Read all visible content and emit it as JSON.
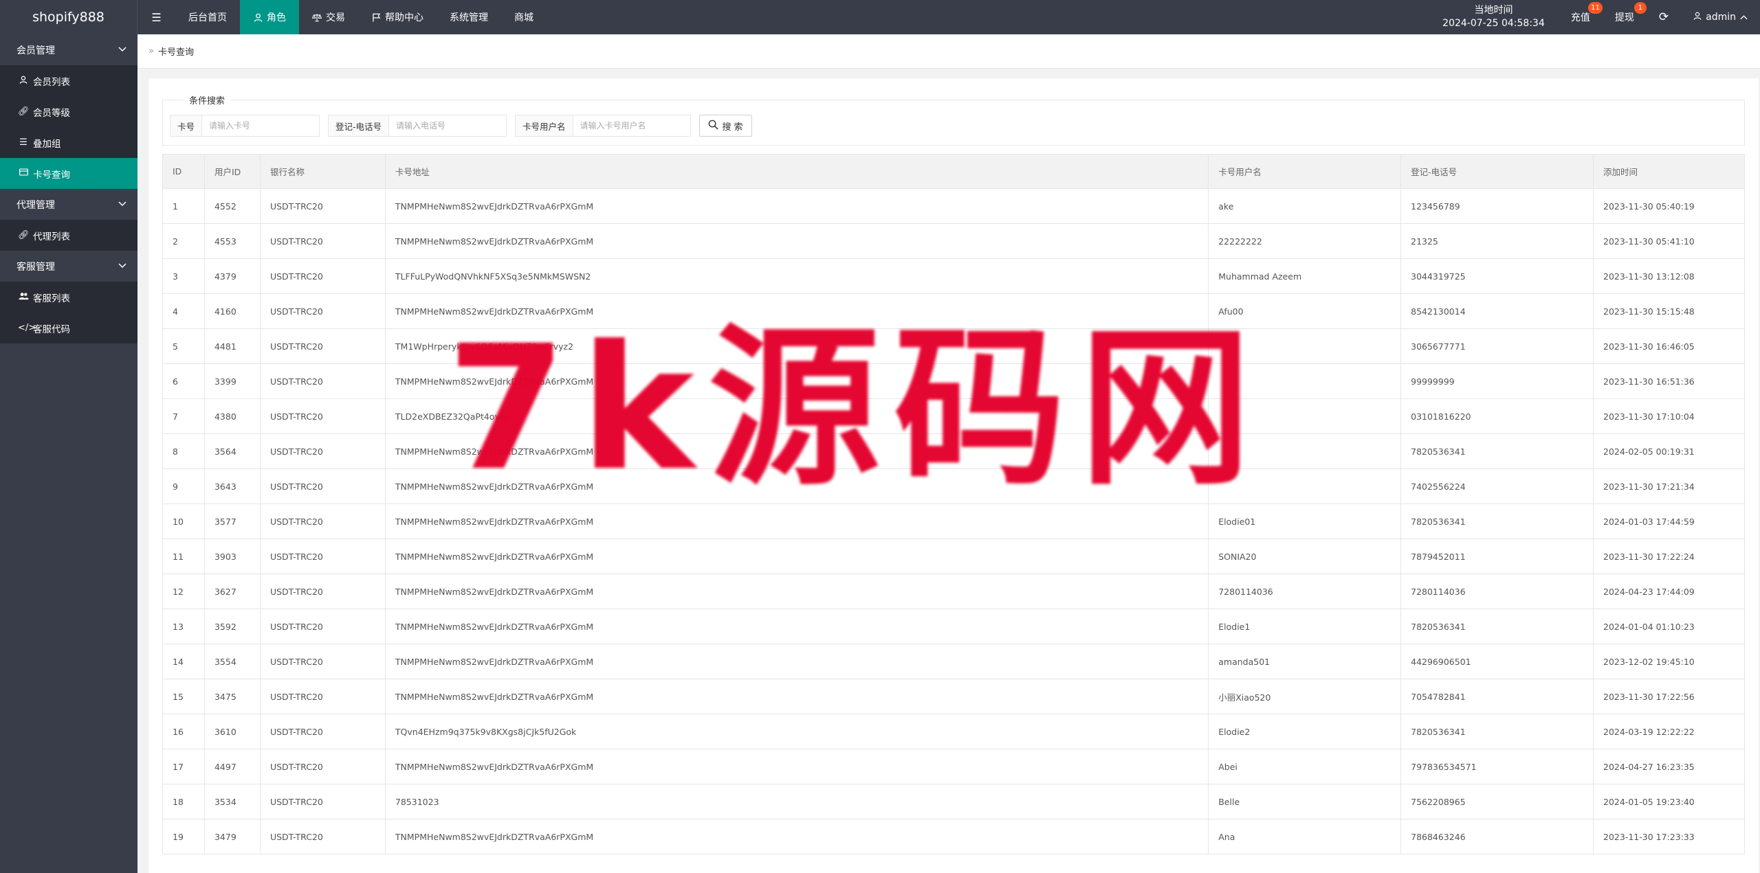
{
  "app": {
    "logo": "shopify888"
  },
  "top_nav": {
    "items": [
      {
        "label": "后台首页",
        "icon": ""
      },
      {
        "label": "角色",
        "icon": "user-icon",
        "active": true
      },
      {
        "label": "交易",
        "icon": "scale-icon"
      },
      {
        "label": "帮助中心",
        "icon": "flag-icon"
      },
      {
        "label": "系统管理",
        "icon": ""
      },
      {
        "label": "商城",
        "icon": ""
      }
    ]
  },
  "header_right": {
    "time_label": "当地时间",
    "time_value": "2024-07-25 04:58:34",
    "recharge_label": "充值",
    "recharge_badge": "11",
    "withdraw_label": "提现",
    "withdraw_badge": "1",
    "admin_label": "admin"
  },
  "sidebar": {
    "groups": [
      {
        "label": "会员管理",
        "items": [
          "会员列表",
          "会员等级",
          "叠加组",
          "卡号查询"
        ]
      },
      {
        "label": "代理管理",
        "items": [
          "代理列表"
        ]
      },
      {
        "label": "客服管理",
        "items": [
          "客服列表",
          "客服代码"
        ]
      }
    ]
  },
  "breadcrumb": {
    "current": "卡号查询"
  },
  "search": {
    "legend": "条件搜索",
    "card_label": "卡号",
    "card_placeholder": "请输入卡号",
    "phone_label": "登记-电话号",
    "phone_placeholder": "请输入电话号",
    "username_label": "卡号用户名",
    "username_placeholder": "请输入卡号用户名",
    "button_label": "搜 索"
  },
  "table": {
    "headers": [
      "ID",
      "用户ID",
      "银行名称",
      "卡号地址",
      "卡号用户名",
      "登记-电话号",
      "添加时间"
    ],
    "rows": [
      [
        "1",
        "4552",
        "USDT-TRC20",
        "TNMPMHeNwm8S2wvEJdrkDZTRvaA6rPXGmM",
        "ake",
        "123456789",
        "2023-11-30 05:40:19"
      ],
      [
        "2",
        "4553",
        "USDT-TRC20",
        "TNMPMHeNwm8S2wvEJdrkDZTRvaA6rPXGmM",
        "22222222",
        "21325",
        "2023-11-30 05:41:10"
      ],
      [
        "3",
        "4379",
        "USDT-TRC20",
        "TLFFuLPyWodQNVhkNF5XSq3e5NMkMSWSN2",
        "Muhammad Azeem",
        "3044319725",
        "2023-11-30 13:12:08"
      ],
      [
        "4",
        "4160",
        "USDT-TRC20",
        "TNMPMHeNwm8S2wvEJdrkDZTRvaA6rPXGmM",
        "Afu00",
        "8542130014",
        "2023-11-30 15:15:48"
      ],
      [
        "5",
        "4481",
        "USDT-TRC20",
        "TM1WpHrperykJJrv6Q6aMjvDH79w6rvyz2",
        "",
        "3065677771",
        "2023-11-30 16:46:05"
      ],
      [
        "6",
        "3399",
        "USDT-TRC20",
        "TNMPMHeNwm8S2wvEJdrkDZTRvaA6rPXGmM",
        "",
        "99999999",
        "2023-11-30 16:51:36"
      ],
      [
        "7",
        "4380",
        "USDT-TRC20",
        "TLD2eXDBEZ32QaPt4oykL",
        "",
        "03101816220",
        "2023-11-30 17:10:04"
      ],
      [
        "8",
        "3564",
        "USDT-TRC20",
        "TNMPMHeNwm8S2wvEJdrkDZTRvaA6rPXGmM",
        "",
        "7820536341",
        "2024-02-05 00:19:31"
      ],
      [
        "9",
        "3643",
        "USDT-TRC20",
        "TNMPMHeNwm8S2wvEJdrkDZTRvaA6rPXGmM",
        "",
        "7402556224",
        "2023-11-30 17:21:34"
      ],
      [
        "10",
        "3577",
        "USDT-TRC20",
        "TNMPMHeNwm8S2wvEJdrkDZTRvaA6rPXGmM",
        "Elodie01",
        "7820536341",
        "2024-01-03 17:44:59"
      ],
      [
        "11",
        "3903",
        "USDT-TRC20",
        "TNMPMHeNwm8S2wvEJdrkDZTRvaA6rPXGmM",
        "SONIA20",
        "7879452011",
        "2023-11-30 17:22:24"
      ],
      [
        "12",
        "3627",
        "USDT-TRC20",
        "TNMPMHeNwm8S2wvEJdrkDZTRvaA6rPXGmM",
        "7280114036",
        "7280114036",
        "2024-04-23 17:44:09"
      ],
      [
        "13",
        "3592",
        "USDT-TRC20",
        "TNMPMHeNwm8S2wvEJdrkDZTRvaA6rPXGmM",
        "Elodie1",
        "7820536341",
        "2024-01-04 01:10:23"
      ],
      [
        "14",
        "3554",
        "USDT-TRC20",
        "TNMPMHeNwm8S2wvEJdrkDZTRvaA6rPXGmM",
        "amanda501",
        "44296906501",
        "2023-12-02 19:45:10"
      ],
      [
        "15",
        "3475",
        "USDT-TRC20",
        "TNMPMHeNwm8S2wvEJdrkDZTRvaA6rPXGmM",
        "小丽Xiao520",
        "7054782841",
        "2023-11-30 17:22:56"
      ],
      [
        "16",
        "3610",
        "USDT-TRC20",
        "TQvn4EHzm9q375k9v8KXgs8jCJk5fU2Gok",
        "Elodie2",
        "7820536341",
        "2024-03-19 12:22:22"
      ],
      [
        "17",
        "4497",
        "USDT-TRC20",
        "TNMPMHeNwm8S2wvEJdrkDZTRvaA6rPXGmM",
        "Abei",
        "797836534571",
        "2024-04-27 16:23:35"
      ],
      [
        "18",
        "3534",
        "USDT-TRC20",
        "78531023",
        "Belle",
        "7562208965",
        "2024-01-05 19:23:40"
      ],
      [
        "19",
        "3479",
        "USDT-TRC20",
        "TNMPMHeNwm8S2wvEJdrkDZTRvaA6rPXGmM",
        "Ana",
        "7868463246",
        "2023-11-30 17:23:33"
      ]
    ]
  },
  "watermark": "7k源码网",
  "colors": {
    "header_bg": "#393d49",
    "accent": "#009688",
    "badge": "#ff5722",
    "watermark": "#e4002b"
  }
}
